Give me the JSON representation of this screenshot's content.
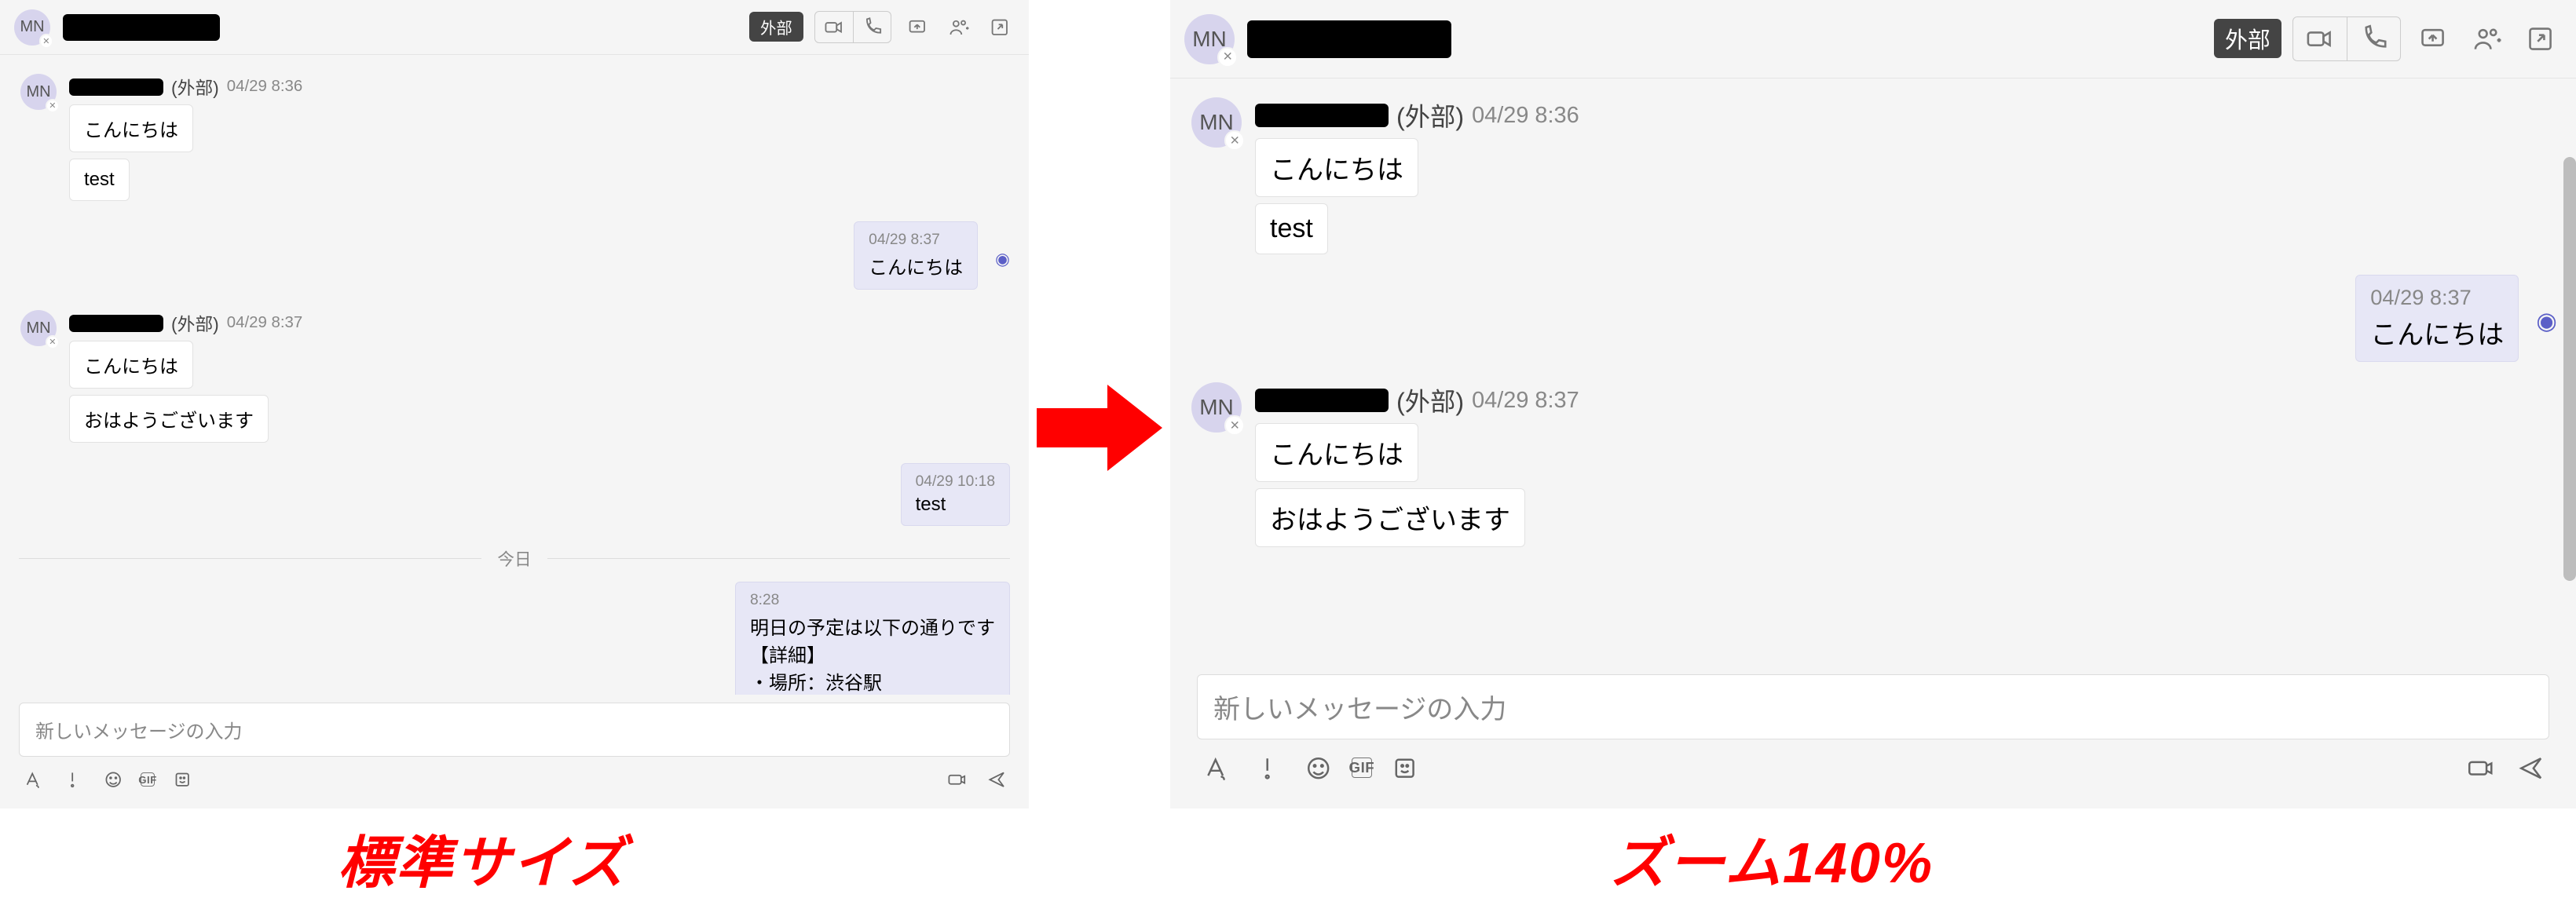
{
  "header": {
    "avatar_initials": "MN",
    "external_badge": "外部"
  },
  "leftChat": {
    "blocks": [
      {
        "type": "other",
        "ext": "(外部)",
        "ts": "04/29 8:36",
        "bubbles": [
          "こんにちは",
          "test"
        ]
      },
      {
        "type": "me",
        "ts": "04/29 8:37",
        "bubbles": [
          "こんにちは"
        ],
        "seen": true
      },
      {
        "type": "other",
        "ext": "(外部)",
        "ts": "04/29 8:37",
        "bubbles": [
          "こんにちは",
          "おはようございます"
        ]
      },
      {
        "type": "me",
        "ts": "04/29 10:18",
        "bubbles": [
          "test"
        ]
      },
      {
        "type": "daysep",
        "label": "今日"
      },
      {
        "type": "me",
        "ts": "8:28",
        "bubbles": [
          "明日の予定は以下の通りです\n【詳細】\n・場所：渋谷駅"
        ]
      }
    ]
  },
  "rightChat": {
    "blocks": [
      {
        "type": "other",
        "ext": "(外部)",
        "ts": "04/29 8:36",
        "bubbles": [
          "こんにちは",
          "test"
        ]
      },
      {
        "type": "me",
        "ts": "04/29 8:37",
        "bubbles": [
          "こんにちは"
        ],
        "seen": true
      },
      {
        "type": "other",
        "ext": "(外部)",
        "ts": "04/29 8:37",
        "bubbles": [
          "こんにちは",
          "おはようございます"
        ]
      }
    ]
  },
  "composer": {
    "placeholder": "新しいメッセージの入力",
    "gif_label": "GIF"
  },
  "captions": {
    "left": "標準サイズ",
    "right": "ズーム140%"
  }
}
